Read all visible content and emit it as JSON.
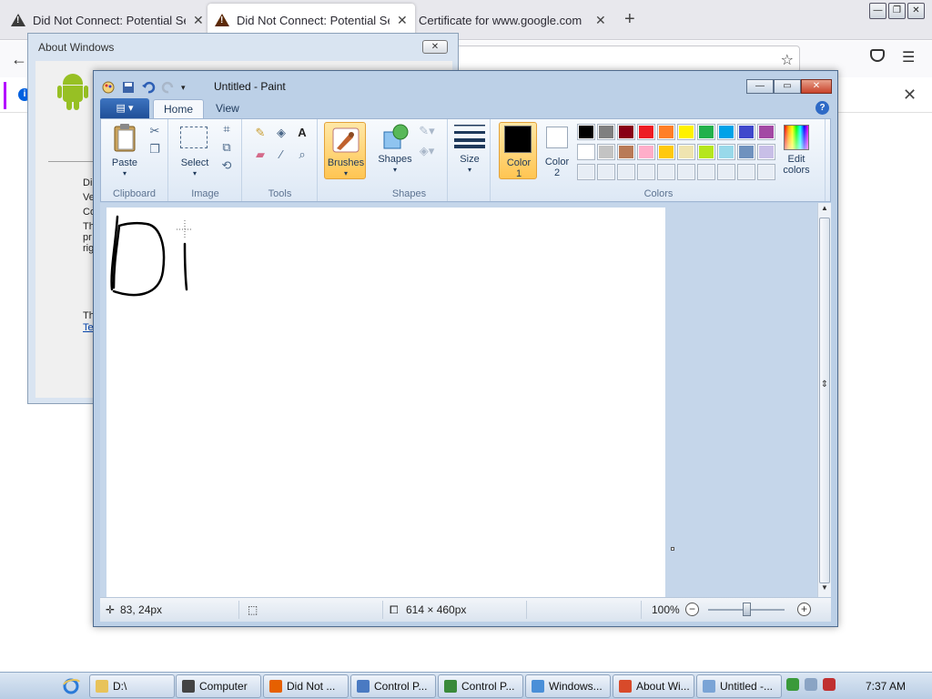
{
  "browser": {
    "tabs": [
      {
        "title": "Did Not Connect: Potential Security Issue",
        "active": false
      },
      {
        "title": "Did Not Connect: Potential Security Issue",
        "active": true
      },
      {
        "title": "Certificate for www.google.com",
        "active": false
      }
    ],
    "new_tab_label": "+"
  },
  "about_dialog": {
    "title": "About Windows",
    "lines_truncated": [
      "Di",
      "Ve",
      "Co",
      "Th",
      "pr",
      "rig",
      "Th"
    ],
    "link_fragment": "Te"
  },
  "paint": {
    "title": "Untitled - Paint",
    "tabs": [
      "Home",
      "View"
    ],
    "groups": {
      "clipboard": {
        "label": "Clipboard",
        "paste": "Paste"
      },
      "image": {
        "label": "Image",
        "select": "Select"
      },
      "tools": {
        "label": "Tools"
      },
      "brushes": {
        "label": "Brushes"
      },
      "shapes": {
        "label": "Shapes",
        "button": "Shapes"
      },
      "size": {
        "label": "Size"
      },
      "colors": {
        "label": "Colors",
        "color1_line1": "Color",
        "color1_line2": "1",
        "color2_line1": "Color",
        "color2_line2": "2",
        "edit_line1": "Edit",
        "edit_line2": "colors",
        "color1_value": "#000000",
        "color2_value": "#ffffff",
        "palette_row1": [
          "#000000",
          "#7f7f7f",
          "#880015",
          "#ed1c24",
          "#ff7f27",
          "#fff200",
          "#22b14c",
          "#00a2e8",
          "#3f48cc",
          "#a349a4"
        ],
        "palette_row2": [
          "#ffffff",
          "#c3c3c3",
          "#b97a57",
          "#ffaec9",
          "#ffc90e",
          "#efe4b0",
          "#b5e61d",
          "#99d9ea",
          "#7092be",
          "#c8bfe7"
        ]
      }
    },
    "status": {
      "cursor_pos": "83, 24px",
      "canvas_size": "614 × 460px",
      "zoom": "100%"
    }
  },
  "taskbar": {
    "items": [
      {
        "label": "D:\\",
        "icon_color": "#e8c35a"
      },
      {
        "label": "Computer",
        "icon_color": "#444444"
      },
      {
        "label": "Did Not ...",
        "icon_color": "#e66000"
      },
      {
        "label": "Control P...",
        "icon_color": "#4a7ac2"
      },
      {
        "label": "Control P...",
        "icon_color": "#3a8a3a"
      },
      {
        "label": "Windows...",
        "icon_color": "#4a8fd8"
      },
      {
        "label": "About Wi...",
        "icon_color": "#d84a2a"
      },
      {
        "label": "Untitled -...",
        "icon_color": "#7aa4d6"
      }
    ],
    "clock": "7:37 AM"
  }
}
